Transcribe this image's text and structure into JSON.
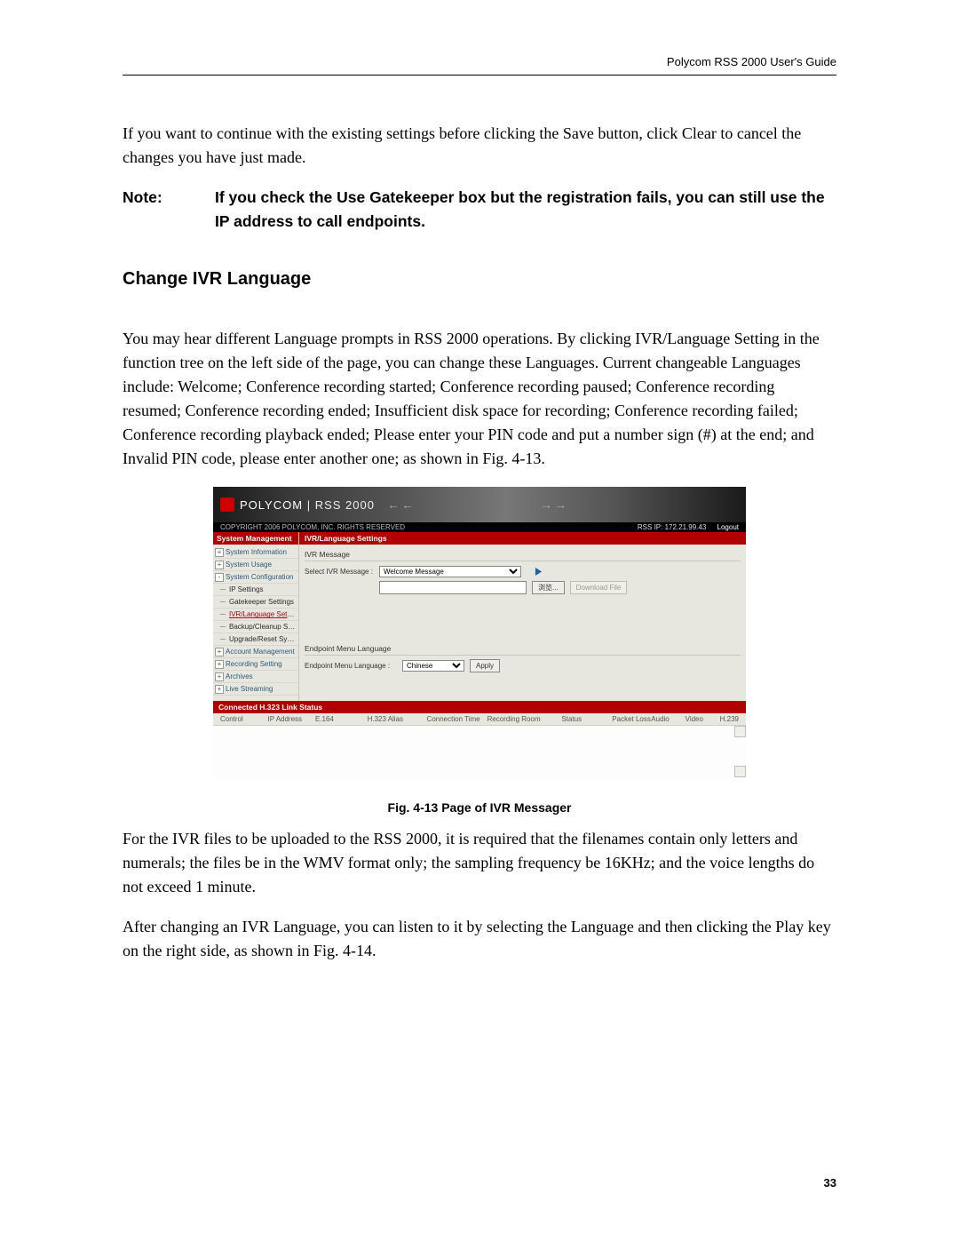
{
  "header": {
    "guide": "Polycom RSS 2000 User's Guide"
  },
  "body": {
    "p1": "If you want to continue with the existing settings before clicking the Save button, click Clear to cancel the changes you have just made.",
    "note_label": "Note:",
    "note_text": "If you check the Use Gatekeeper box but the registration fails, you can still use the IP address to call endpoints.",
    "section_title": "Change IVR Language",
    "p2": "You may hear different Language prompts in RSS 2000 operations. By clicking IVR/Language Setting in the function tree on the left side of the page, you can change these Languages. Current changeable Languages include: Welcome; Conference recording started; Conference recording paused; Conference recording resumed; Conference recording ended; Insufficient disk space for recording; Conference recording failed; Conference recording playback ended; Please enter your PIN code and put a number sign (#) at the end; and Invalid PIN code, please enter another one; as shown in Fig. 4-13.",
    "p3": "For the IVR files to be uploaded to the RSS 2000, it is required that the filenames contain only letters and numerals; the files be in the WMV format only; the sampling frequency be 16KHz; and the voice lengths do not exceed 1 minute.",
    "p4": "After changing an IVR Language, you can listen to it by selecting the Language and then clicking the Play key on the right side, as shown in Fig. 4-14."
  },
  "figure": {
    "brand_main": "POLYCOM",
    "brand_sub": "RSS 2000",
    "copyright": "COPYRIGHT 2006 POLYCOM, INC.   RIGHTS RESERVED",
    "rss_ip_label": "RSS IP: 172.21.99.43",
    "logout": "Logout",
    "sidebar": {
      "header": "System Management",
      "items": [
        {
          "label": "System Information",
          "type": "top",
          "pm": "+"
        },
        {
          "label": "System Usage",
          "type": "top",
          "pm": "+"
        },
        {
          "label": "System Configuration",
          "type": "top",
          "pm": "-"
        },
        {
          "label": "IP Settings",
          "type": "sub"
        },
        {
          "label": "Gatekeeper Settings",
          "type": "sub"
        },
        {
          "label": "IVR/Language Settings",
          "type": "sub",
          "selected": true
        },
        {
          "label": "Backup/Cleanup Settings",
          "type": "sub"
        },
        {
          "label": "Upgrade/Reset System",
          "type": "sub"
        },
        {
          "label": "Account Management",
          "type": "top",
          "pm": "+"
        },
        {
          "label": "Recording Setting",
          "type": "top",
          "pm": "+"
        },
        {
          "label": "Archives",
          "type": "top",
          "pm": "+"
        },
        {
          "label": "Live Streaming",
          "type": "top",
          "pm": "+"
        }
      ]
    },
    "main": {
      "header": "IVR/Language Settings",
      "section1_title": "IVR Message",
      "select_label": "Select IVR Message :",
      "select_value": "Welcome Message",
      "browse_label": "浏览...",
      "download_label": "Download File",
      "section2_title": "Endpoint Menu Language",
      "lang_label": "Endpoint Menu Language :",
      "lang_value": "Chinese",
      "apply_label": "Apply"
    },
    "status": {
      "header": "Connected H.323 Link Status",
      "cols": [
        "Control",
        "IP Address",
        "E.164",
        "H.323 Alias",
        "Connection Time",
        "Recording Room",
        "Status",
        "Packet Loss",
        "Audio",
        "Video",
        "H.239"
      ]
    },
    "caption": "Fig. 4-13 Page of IVR Messager"
  },
  "page_number": "33"
}
